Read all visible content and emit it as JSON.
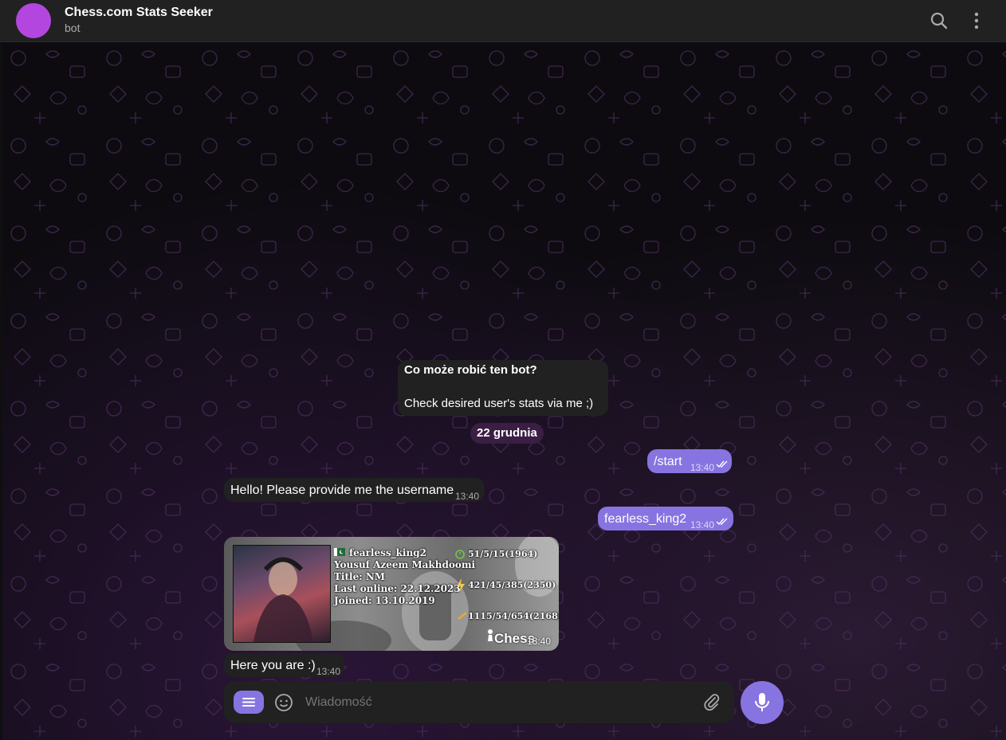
{
  "header": {
    "title": "Chess.com Stats Seeker",
    "subtitle": "bot",
    "avatar_color": "#b446e0"
  },
  "icons": {
    "search": "search-icon",
    "menu": "more-vertical-icon"
  },
  "messages": [
    {
      "type": "info",
      "title": "Co może robić ten bot?",
      "text": "Check desired user's stats via me ;)"
    },
    {
      "type": "date",
      "text": "22 grudnia"
    },
    {
      "type": "out",
      "text": "/start",
      "time": "13:40"
    },
    {
      "type": "in",
      "text": "Hello! Please provide me the username",
      "time": "13:40"
    },
    {
      "type": "out",
      "text": "fearless_king2",
      "time": "13:40"
    },
    {
      "type": "in-image",
      "time": "13:40",
      "card": {
        "username": "fearless_king2",
        "full_name": "Yousuf Azeem Makhdoomi",
        "title": "Title: NM",
        "last_online": "Last online: 22.12.2023",
        "joined": "Joined: 13.10.2019",
        "rapid": "51/5/15(1964)",
        "blitz": "421/45/385(2350)",
        "bullet": "1115/54/654(2168)",
        "brand": "Chess"
      }
    },
    {
      "type": "in",
      "text": "Here you are :)",
      "time": "13:40"
    }
  ],
  "composer": {
    "placeholder": "Wiadomość"
  },
  "colors": {
    "accent": "#8774e1",
    "incoming_bubble": "#212121",
    "header_bg": "#212121",
    "date_pill": "#3a1e44"
  }
}
